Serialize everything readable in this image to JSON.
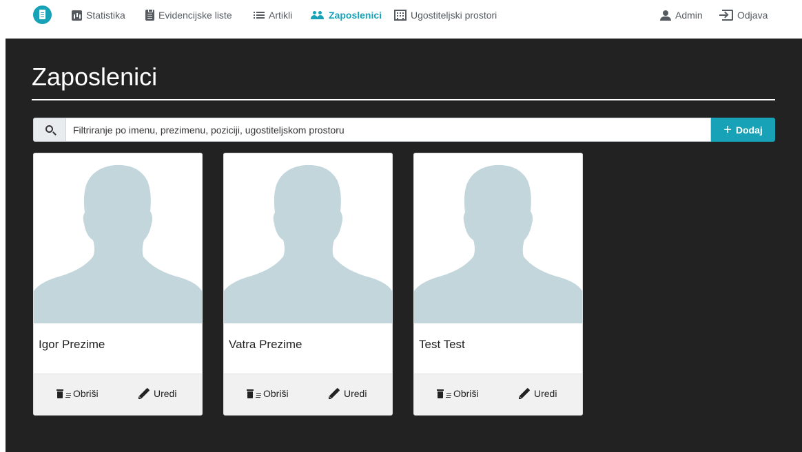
{
  "nav": {
    "logo_icon": "document-icon",
    "items": [
      {
        "label": "Statistika",
        "icon": "bar-chart-icon",
        "active": false
      },
      {
        "label": "Evidencijske liste",
        "icon": "clipboard-icon",
        "active": false
      },
      {
        "label": "Artikli",
        "icon": "list-icon",
        "active": false
      },
      {
        "label": "Zaposlenici",
        "icon": "people-icon",
        "active": true
      },
      {
        "label": "Ugostiteljski prostori",
        "icon": "building-icon",
        "active": false
      }
    ],
    "user_label": "Admin",
    "logout_label": "Odjava"
  },
  "page": {
    "title": "Zaposlenici"
  },
  "search": {
    "placeholder": "Filtriranje po imenu, prezimenu, poziciji, ugostiteljskom prostoru",
    "value": ""
  },
  "add_button": {
    "label": "Dodaj"
  },
  "employees": [
    {
      "name": "Igor Prezime",
      "delete_label": "Obriši",
      "edit_label": "Uredi"
    },
    {
      "name": "Vatra Prezime",
      "delete_label": "Obriši",
      "edit_label": "Uredi"
    },
    {
      "name": "Test Test",
      "delete_label": "Obriši",
      "edit_label": "Uredi"
    }
  ],
  "colors": {
    "accent": "#17a2b8",
    "panel_background": "#222222",
    "avatar_silhouette": "#c2d6dc"
  }
}
